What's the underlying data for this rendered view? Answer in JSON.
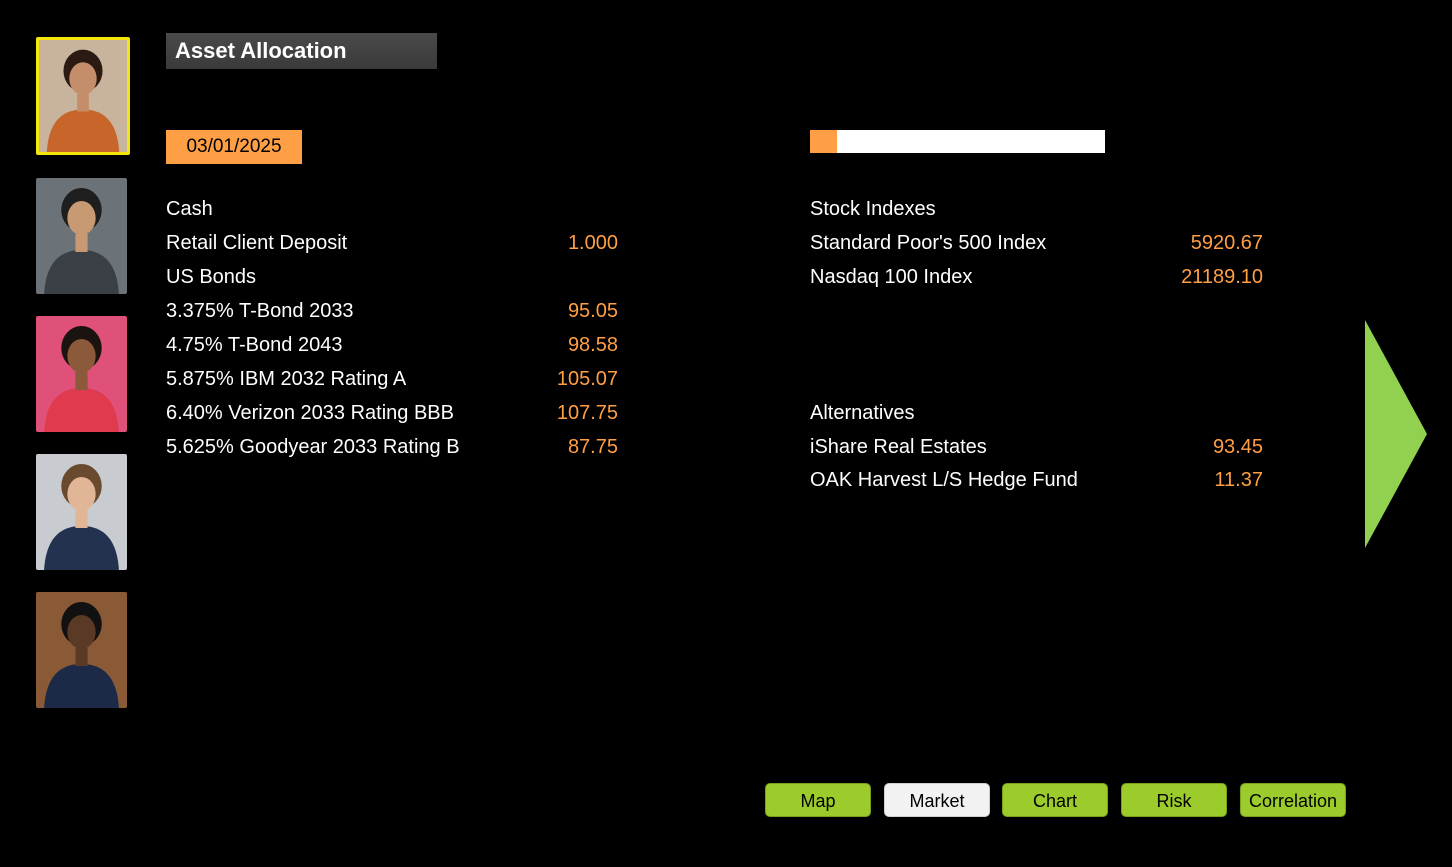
{
  "header": {
    "title": "Asset Allocation",
    "date": "03/01/2025",
    "progress_fraction": 0.09
  },
  "avatars": [
    {
      "name": "avatar-woman-orange-blazer",
      "selected": true,
      "bg": "#c8b49c",
      "clothing": "#c8652a",
      "skin": "#c58e6a",
      "hair": "#2a1a12"
    },
    {
      "name": "avatar-man-grey-suit-tablet",
      "selected": false,
      "bg": "#6b7378",
      "clothing": "#3b4046",
      "skin": "#c89a74",
      "hair": "#1e1e1e"
    },
    {
      "name": "avatar-woman-pink-background",
      "selected": false,
      "bg": "#e0517a",
      "clothing": "#e03a4e",
      "skin": "#8a5a3a",
      "hair": "#1b1310"
    },
    {
      "name": "avatar-man-navy-suit-arms-crossed",
      "selected": false,
      "bg": "#c8ccd0",
      "clothing": "#22324f",
      "skin": "#e1b697",
      "hair": "#6a4a2e"
    },
    {
      "name": "avatar-man-navy-suit-bookshelf",
      "selected": false,
      "bg": "#8a5a36",
      "clothing": "#1c2a48",
      "skin": "#5a3a24",
      "hair": "#111111"
    }
  ],
  "left_column": [
    {
      "label": "Cash",
      "value": ""
    },
    {
      "label": "Retail Client Deposit",
      "value": "1.000"
    },
    {
      "label": "US Bonds",
      "value": ""
    },
    {
      "label": "3.375% T-Bond 2033",
      "value": "95.05"
    },
    {
      "label": "4.75% T-Bond 2043",
      "value": "98.58"
    },
    {
      "label": "5.875% IBM 2032 Rating A",
      "value": "105.07"
    },
    {
      "label": "6.40% Verizon 2033 Rating BBB",
      "value": "107.75"
    },
    {
      "label": "5.625% Goodyear 2033 Rating B",
      "value": "87.75"
    }
  ],
  "right_column": {
    "stocks": [
      {
        "label": "Stock Indexes",
        "value": ""
      },
      {
        "label": "Standard Poor's 500 Index",
        "value": "5920.67"
      },
      {
        "label": "Nasdaq 100 Index",
        "value": "21189.10"
      }
    ],
    "alternatives": [
      {
        "label": "Alternatives",
        "value": ""
      },
      {
        "label": "iShare Real Estates",
        "value": "93.45"
      },
      {
        "label": "OAK Harvest L/S Hedge Fund",
        "value": "11.37"
      }
    ]
  },
  "nav": [
    {
      "label": "Map",
      "active": false
    },
    {
      "label": "Market",
      "active": true
    },
    {
      "label": "Chart",
      "active": false
    },
    {
      "label": "Risk",
      "active": false
    },
    {
      "label": "Correlation",
      "active": false
    }
  ],
  "colors": {
    "accent_orange": "#ff9f45",
    "nav_green": "#9ccb2c",
    "arrow_green": "#92d050",
    "selected_border": "#f4e60c"
  },
  "icons": {
    "next": "triangle-right-icon"
  }
}
